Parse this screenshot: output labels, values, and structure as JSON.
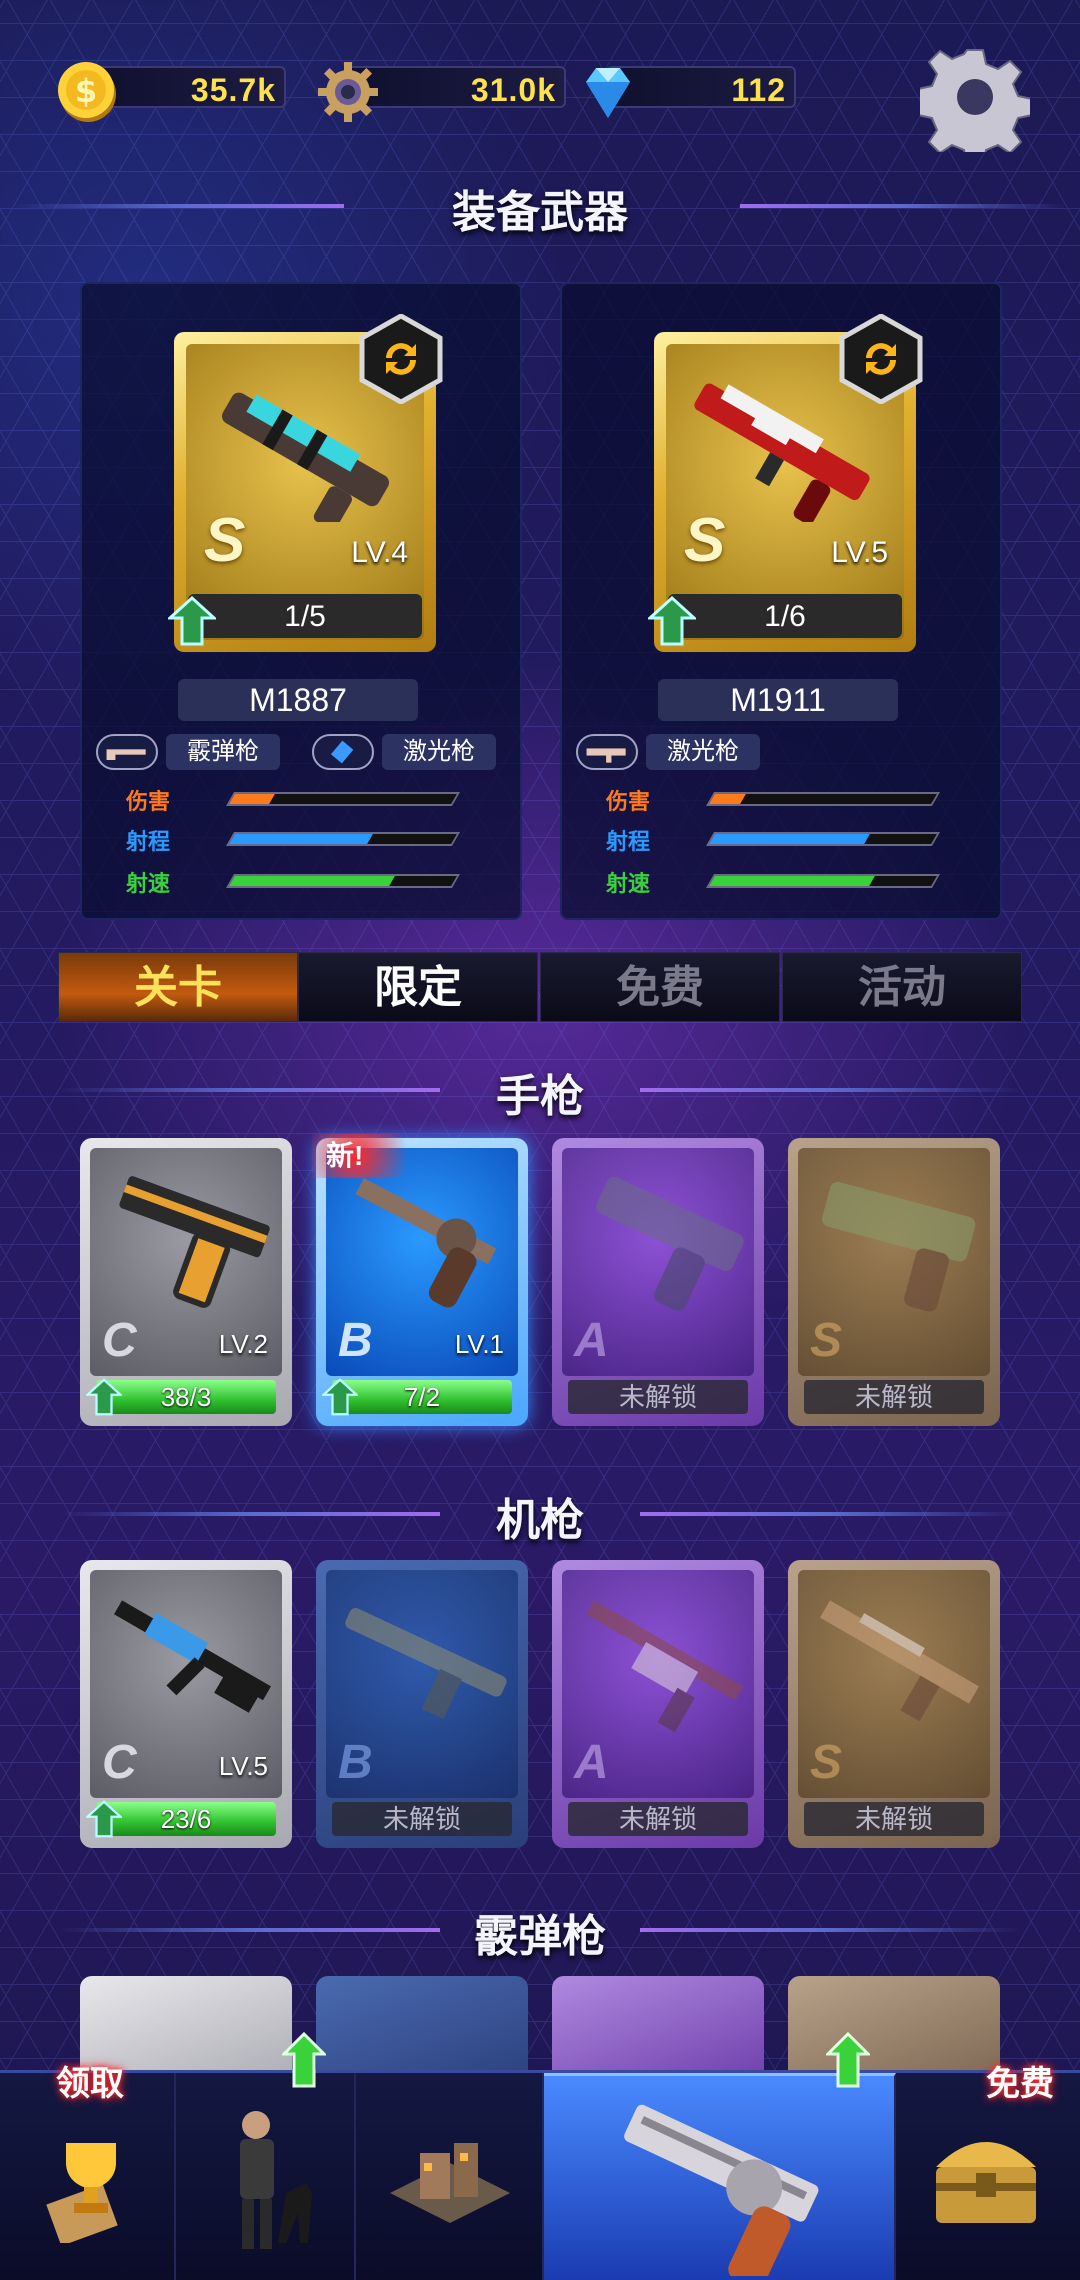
{
  "currency": {
    "coins": "35.7k",
    "gears": "31.0k",
    "gems": "112"
  },
  "header": {
    "title": "装备武器"
  },
  "equipped": [
    {
      "name": "M1887",
      "grade": "S",
      "level": "LV.4",
      "progress": "1/5",
      "types": [
        "霰弹枪",
        "激光枪"
      ],
      "stats": [
        {
          "label": "伤害",
          "value": 0.18,
          "color": "#ff7a1a"
        },
        {
          "label": "射程",
          "value": 0.62,
          "color": "#2a9aff"
        },
        {
          "label": "射速",
          "value": 0.72,
          "color": "#3ad23a"
        }
      ]
    },
    {
      "name": "M1911",
      "grade": "S",
      "level": "LV.5",
      "progress": "1/6",
      "types": [
        "激光枪"
      ],
      "stats": [
        {
          "label": "伤害",
          "value": 0.14,
          "color": "#ff7a1a"
        },
        {
          "label": "射程",
          "value": 0.7,
          "color": "#2a9aff"
        },
        {
          "label": "射速",
          "value": 0.72,
          "color": "#3ad23a"
        }
      ]
    }
  ],
  "tabs": [
    {
      "label": "关卡",
      "active": true
    },
    {
      "label": "限定",
      "active": false
    },
    {
      "label": "免费",
      "active": false
    },
    {
      "label": "活动",
      "active": false
    }
  ],
  "sections": [
    {
      "title": "手枪",
      "items": [
        {
          "grade": "C",
          "level": "LV.2",
          "bar": "38/3",
          "new": false
        },
        {
          "grade": "B",
          "level": "LV.1",
          "bar": "7/2",
          "new": true,
          "new_label": "新!"
        },
        {
          "grade": "A",
          "level": "",
          "bar": "未解锁"
        },
        {
          "grade": "S",
          "level": "",
          "bar": "未解锁"
        }
      ]
    },
    {
      "title": "机枪",
      "items": [
        {
          "grade": "C",
          "level": "LV.5",
          "bar": "23/6"
        },
        {
          "grade": "B",
          "level": "",
          "bar": "未解锁"
        },
        {
          "grade": "A",
          "level": "",
          "bar": "未解锁"
        },
        {
          "grade": "S",
          "level": "",
          "bar": "未解锁"
        }
      ]
    },
    {
      "title": "霰弹枪"
    }
  ],
  "nav": {
    "left_label": "领取",
    "right_label": "免费"
  }
}
